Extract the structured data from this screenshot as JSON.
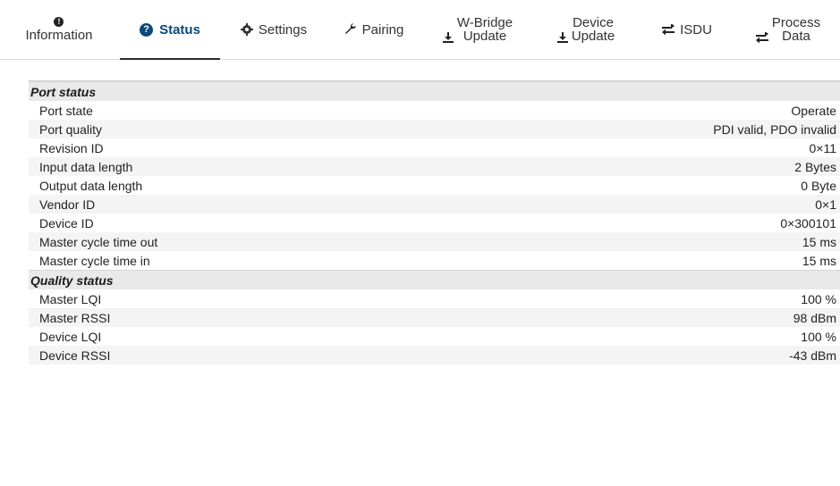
{
  "tabs": {
    "information": "Information",
    "status": "Status",
    "settings": "Settings",
    "pairing": "Pairing",
    "wbridge_update": [
      "W-Bridge",
      "Update"
    ],
    "device_update": [
      "Device",
      "Update"
    ],
    "isdu": "ISDU",
    "process_data": [
      "Process",
      "Data"
    ]
  },
  "port_status": {
    "title": "Port status",
    "rows": [
      {
        "key": "Port state",
        "value": "Operate"
      },
      {
        "key": "Port quality",
        "value": "PDI valid, PDO invalid"
      },
      {
        "key": "Revision ID",
        "value": "0×11"
      },
      {
        "key": "Input data length",
        "value": "2 Bytes"
      },
      {
        "key": "Output data length",
        "value": "0 Byte"
      },
      {
        "key": "Vendor ID",
        "value": "0×1"
      },
      {
        "key": "Device ID",
        "value": "0×300101"
      },
      {
        "key": "Master cycle time out",
        "value": "15 ms"
      },
      {
        "key": "Master cycle time in",
        "value": "15 ms"
      }
    ]
  },
  "quality_status": {
    "title": "Quality status",
    "rows": [
      {
        "key": "Master LQI",
        "value": "100 %"
      },
      {
        "key": "Master RSSI",
        "value": "98 dBm"
      },
      {
        "key": "Device LQI",
        "value": "100 %"
      },
      {
        "key": "Device RSSI",
        "value": "-43 dBm"
      }
    ]
  },
  "icons": {
    "information": "info-circle-icon",
    "status": "question-circle-icon",
    "settings": "gear-icon",
    "pairing": "wrench-icon",
    "wbridge_update": "download-icon",
    "device_update": "download-icon",
    "isdu": "swap-arrows-icon",
    "process_data": "swap-arrows-icon"
  },
  "colors": {
    "active_tab": "#0a4a7a",
    "section_bg": "#e9e9e9",
    "row_alt_bg": "#f4f4f4"
  }
}
